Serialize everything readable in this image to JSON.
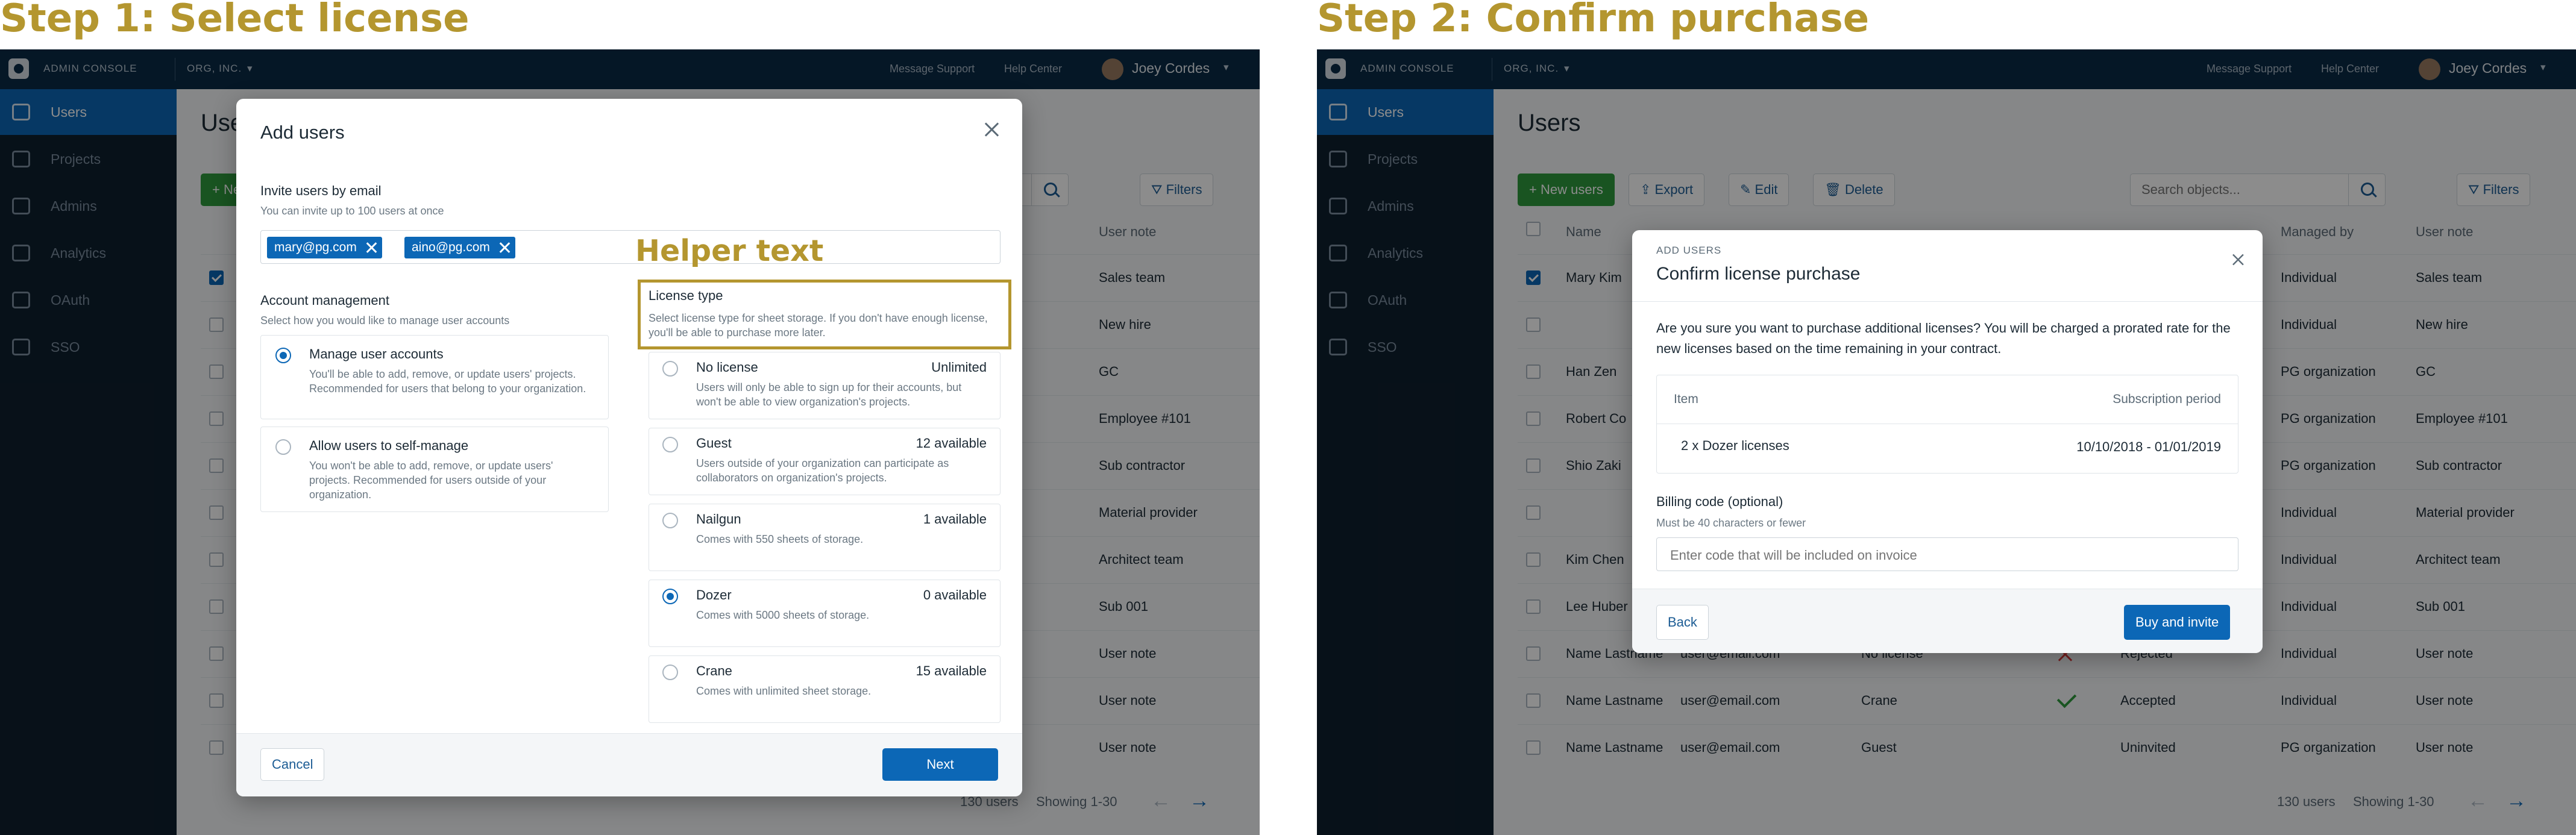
{
  "step1_title": "Step 1: Select license",
  "step2_title": "Step 2: Confirm purchase",
  "annotation_helper_text": "Helper text",
  "topbar": {
    "app_name": "ADMIN CONSOLE",
    "org": "ORG, INC.",
    "message_support": "Message Support",
    "help_center": "Help Center",
    "user_name": "Joey Cordes"
  },
  "sidebar": {
    "items": [
      {
        "label": "Users",
        "icon": "users-icon"
      },
      {
        "label": "Projects",
        "icon": "projects-icon"
      },
      {
        "label": "Admins",
        "icon": "admins-icon"
      },
      {
        "label": "Analytics",
        "icon": "analytics-icon"
      },
      {
        "label": "OAuth",
        "icon": "oauth-icon"
      },
      {
        "label": "SSO",
        "icon": "sso-icon"
      }
    ]
  },
  "page": {
    "title": "Users",
    "new_users": "New users",
    "export": "Export",
    "edit": "Edit",
    "delete": "Delete",
    "search_placeholder": "Search objects...",
    "filters": "Filters",
    "columns": {
      "name": "Name",
      "managed_by": "Managed by",
      "user_note": "User note"
    },
    "users_count": "130 users",
    "showing": "Showing 1-30"
  },
  "left_rows": [
    {
      "note": "Sales team"
    },
    {
      "note": "New hire"
    },
    {
      "note": "GC"
    },
    {
      "note": "Employee #101"
    },
    {
      "note": "Sub contractor"
    },
    {
      "note": "Material provider"
    },
    {
      "note": "Architect team"
    },
    {
      "note": "Sub 001"
    },
    {
      "note": "User note"
    },
    {
      "note": "User note"
    },
    {
      "note": "User note"
    }
  ],
  "right_rows": [
    {
      "name": "Mary Kim",
      "email": "",
      "license": "",
      "status": "",
      "managed": "Individual",
      "note": "Sales team",
      "checked": true
    },
    {
      "name": "",
      "email": "",
      "license": "",
      "status": "",
      "managed": "Individual",
      "note": "New hire",
      "checked": false
    },
    {
      "name": "Han Zen",
      "email": "",
      "license": "",
      "status": "",
      "managed": "PG organization",
      "note": "GC",
      "checked": false
    },
    {
      "name": "Robert Co",
      "email": "",
      "license": "",
      "status": "",
      "managed": "PG organization",
      "note": "Employee #101",
      "checked": false
    },
    {
      "name": "Shio Zaki",
      "email": "",
      "license": "",
      "status": "",
      "managed": "PG organization",
      "note": "Sub contractor",
      "checked": false
    },
    {
      "name": "",
      "email": "",
      "license": "",
      "status": "",
      "managed": "Individual",
      "note": "Material provider",
      "checked": false
    },
    {
      "name": "Kim Chen",
      "email": "",
      "license": "",
      "status": "",
      "managed": "Individual",
      "note": "Architect team",
      "checked": false
    },
    {
      "name": "Lee Huber",
      "email": "",
      "license": "",
      "status": "",
      "managed": "Individual",
      "note": "Sub 001",
      "checked": false
    },
    {
      "name": "Name Lastname",
      "email": "user@email.com",
      "license": "No license",
      "status": "Rejected",
      "managed": "Individual",
      "note": "User note",
      "checked": false
    },
    {
      "name": "Name Lastname",
      "email": "user@email.com",
      "license": "Crane",
      "status": "Accepted",
      "managed": "Individual",
      "note": "User note",
      "checked": false
    },
    {
      "name": "Name Lastname",
      "email": "user@email.com",
      "license": "Guest",
      "status": "Uninvited",
      "managed": "PG organization",
      "note": "User note",
      "checked": false
    }
  ],
  "add_users_modal": {
    "title": "Add users",
    "invite_label": "Invite users by email",
    "invite_help": "You can invite up to 100 users at once",
    "emails": [
      "mary@pg.com",
      "aino@pg.com"
    ],
    "account_mgmt_label": "Account management",
    "account_mgmt_help": "Select how you would like to manage user accounts",
    "manage_title": "Manage user accounts",
    "manage_desc": "You'll be able to add, remove, or update users' projects. Recommended for users that belong to your organization.",
    "self_title": "Allow users to self-manage",
    "self_desc": "You won't be able to add, remove, or update users' projects. Recommended for users outside of your organization.",
    "license_label": "License type",
    "license_help": "Select license type for sheet storage. If you don't have enough license, you'll be able to purchase more later.",
    "licenses": [
      {
        "name": "No license",
        "avail": "Unlimited",
        "desc": "Users will only be able to sign up for their accounts, but won't be able to view organization's projects.",
        "selected": false
      },
      {
        "name": "Guest",
        "avail": "12 available",
        "desc": "Users outside of your organization can participate as collaborators on organization's projects.",
        "selected": false
      },
      {
        "name": "Nailgun",
        "avail": "1 available",
        "desc": "Comes with 550 sheets of storage.",
        "selected": false
      },
      {
        "name": "Dozer",
        "avail": "0 available",
        "desc": "Comes with 5000 sheets of storage.",
        "selected": true
      },
      {
        "name": "Crane",
        "avail": "15 available",
        "desc": "Comes with unlimited sheet storage.",
        "selected": false
      }
    ],
    "cancel": "Cancel",
    "next": "Next"
  },
  "confirm_modal": {
    "eyebrow": "ADD USERS",
    "title": "Confirm license purchase",
    "body": "Are you sure you want to purchase additional licenses? You will be charged a prorated rate for the new licenses based on the time remaining in your contract.",
    "col_item": "Item",
    "col_period": "Subscription period",
    "item": "2 x Dozer licenses",
    "period": "10/10/2018 - 01/01/2019",
    "billing_label": "Billing code (optional)",
    "billing_help": "Must be 40 characters or fewer",
    "billing_placeholder": "Enter code that will be included on invoice",
    "back": "Back",
    "buy": "Buy and invite"
  },
  "colors": {
    "accent": "#B4962F",
    "primary": "#0c67b6",
    "topbar": "#0a2a45",
    "sidebar": "#0e1f2e",
    "green": "#2e9a3c"
  }
}
